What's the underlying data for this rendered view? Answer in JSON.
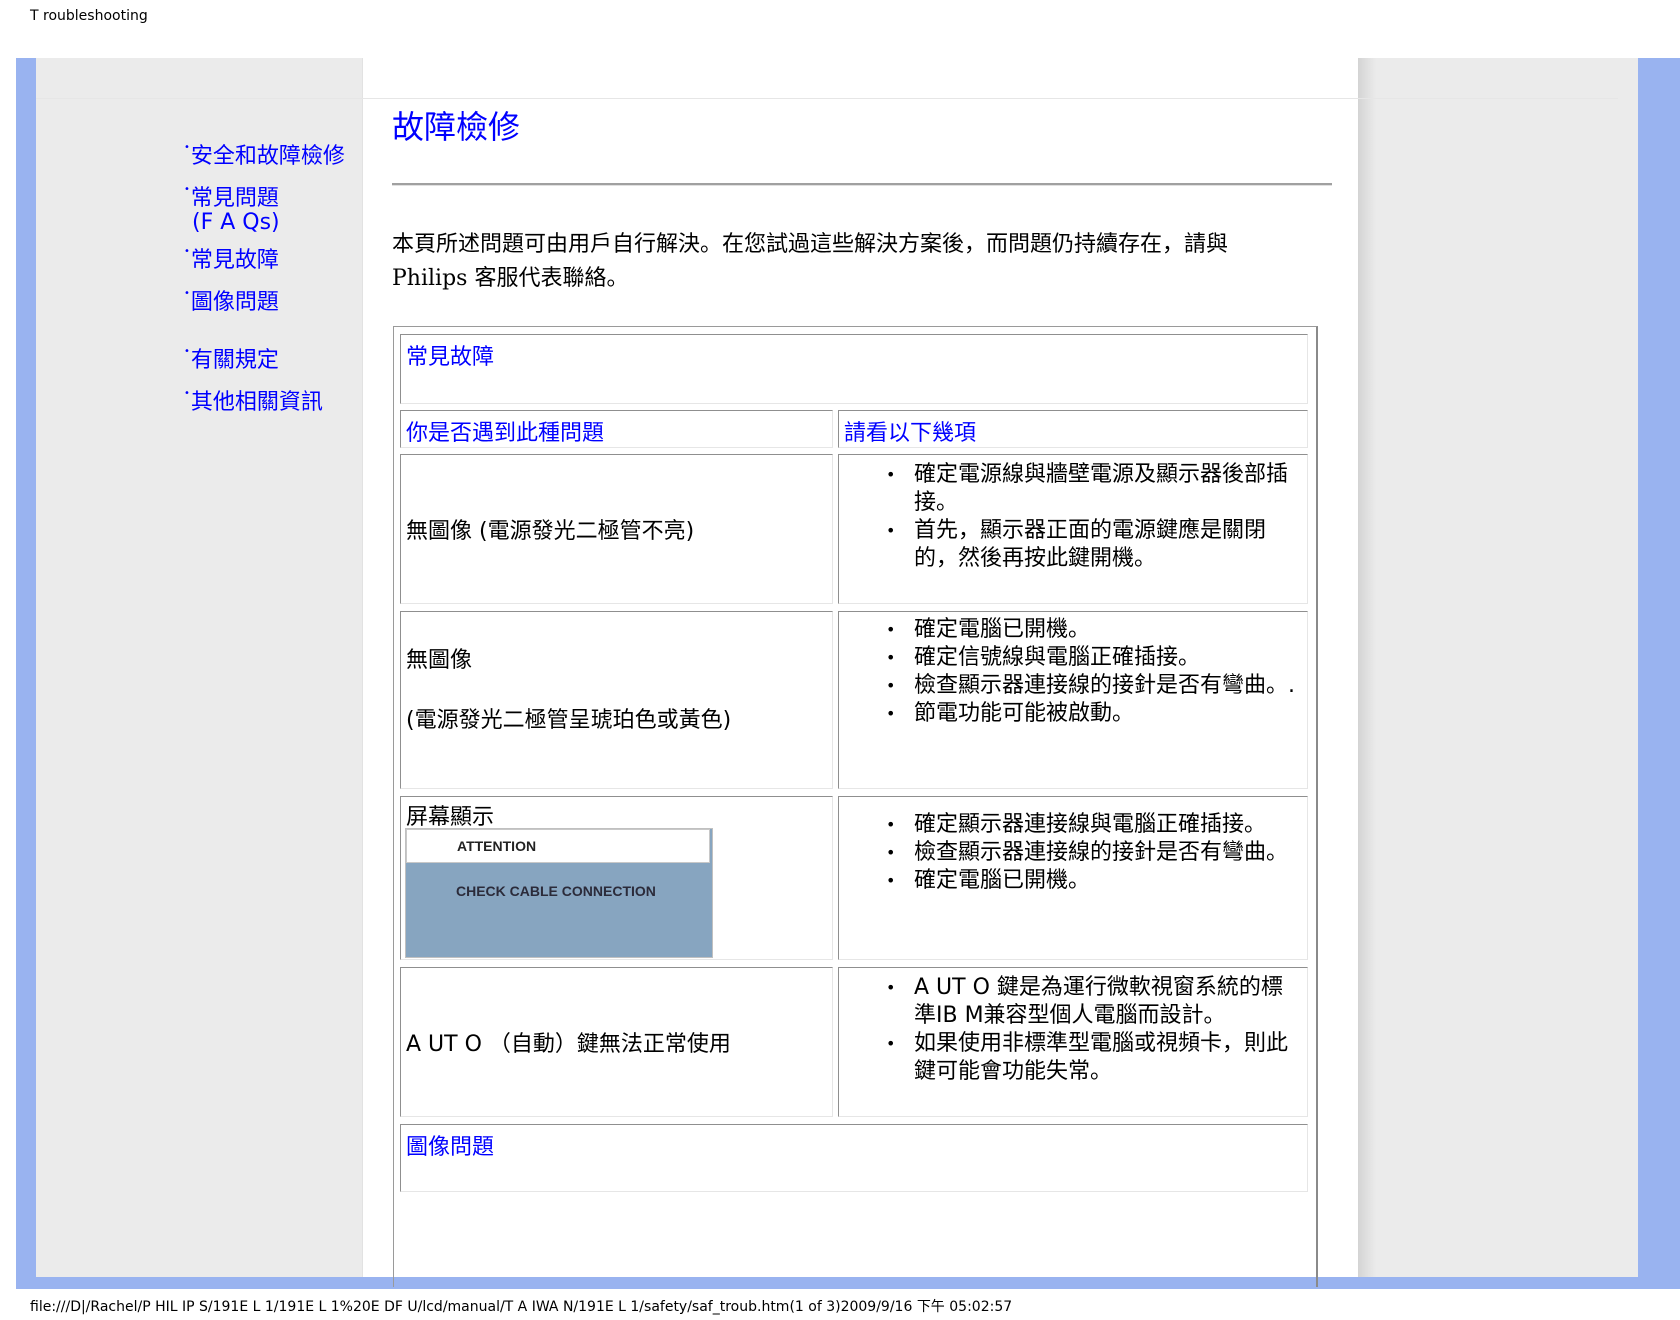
{
  "print_header": "T roubleshooting",
  "print_footer": "file:///D|/Rachel/P HIL IP S/191E L 1/191E L 1%20E DF U/lcd/manual/T A IWA N/191E L 1/safety/saf_troub.htm(1 of 3)2009/9/16 下午 05:02:57",
  "nav": {
    "items": [
      {
        "label": "安全和故障檢修"
      },
      {
        "label": "常見問題"
      },
      {
        "label": "(F A Qs)"
      },
      {
        "label": "常見故障"
      },
      {
        "label": "圖像問題"
      },
      {
        "label": "有關規定"
      },
      {
        "label": "其他相關資訊"
      }
    ]
  },
  "page": {
    "title": "故障檢修",
    "intro_line1": "本頁所述問題可由用戶自行解決。在您試過這些解決方案後，而問題仍持續存在，請與",
    "intro_brand": "Philips",
    "intro_line2": " 客服代表聯絡。"
  },
  "table": {
    "section1": "常見故障",
    "col_problem": "你是否遇到此種問題",
    "col_solution": "請看以下幾項",
    "rows": [
      {
        "problem": "無圖像 (電源發光二極管不亮)",
        "solutions": [
          "確定電源線與牆壁電源及顯示器後部插接。",
          "首先，顯示器正面的電源鍵應是關閉的，然後再按此鍵開機。"
        ]
      },
      {
        "problem_line1": "無圖像",
        "problem_line2": "(電源發光二極管呈琥珀色或黃色)",
        "solutions": [
          "確定電腦已開機。",
          "確定信號線與電腦正確插接。",
          "檢查顯示器連接線的接針是否有彎曲。.",
          "節電功能可能被啟動。"
        ]
      },
      {
        "problem": "屏幕顯示",
        "osd_title": "ATTENTION",
        "osd_message": "CHECK CABLE CONNECTION",
        "solutions": [
          "確定顯示器連接線與電腦正確插接。",
          "檢查顯示器連接線的接針是否有彎曲。",
          "確定電腦已開機。"
        ]
      },
      {
        "problem": "A UT O （自動）鍵無法正常使用",
        "solutions": [
          "A UT O 鍵是為運行微軟視窗系統的標準IB M兼容型個人電腦而設計。",
          "如果使用非標準型電腦或視頻卡，則此鍵可能會功能失常。"
        ]
      }
    ],
    "section2": "圖像問題"
  },
  "colors": {
    "link": "#0000ff",
    "frame": "#99b3f0",
    "panel": "#ebebeb",
    "osd_bg": "#87a5c0"
  }
}
